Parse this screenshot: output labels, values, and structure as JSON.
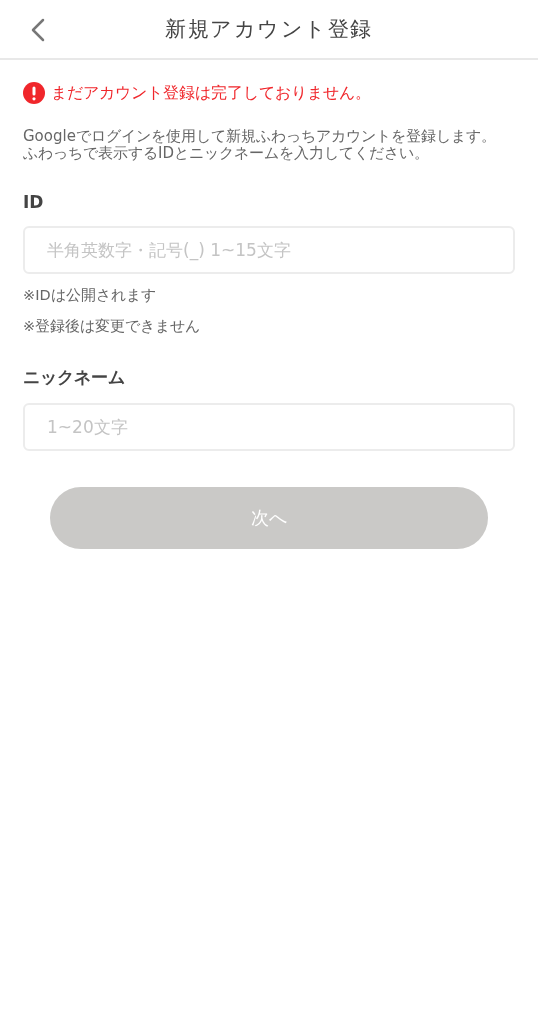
{
  "header": {
    "title": "新規アカウント登録"
  },
  "alert": {
    "text": "まだアカウント登録は完了しておりません。"
  },
  "description": [
    "Googleでログインを使用して新規ふわっちアカウントを登録します。",
    "ふわっちで表示するIDとニックネームを入力してください。"
  ],
  "fields": [
    {
      "label": "ID",
      "placeholder": "半角英数字・記号(_) 1~15文字",
      "notes": [
        "※IDは公開されます",
        "※登録後は変更できません"
      ]
    },
    {
      "label": "ニックネーム",
      "placeholder": "1~20文字"
    }
  ],
  "next_button": {
    "label": "次へ",
    "disabled": true
  }
}
